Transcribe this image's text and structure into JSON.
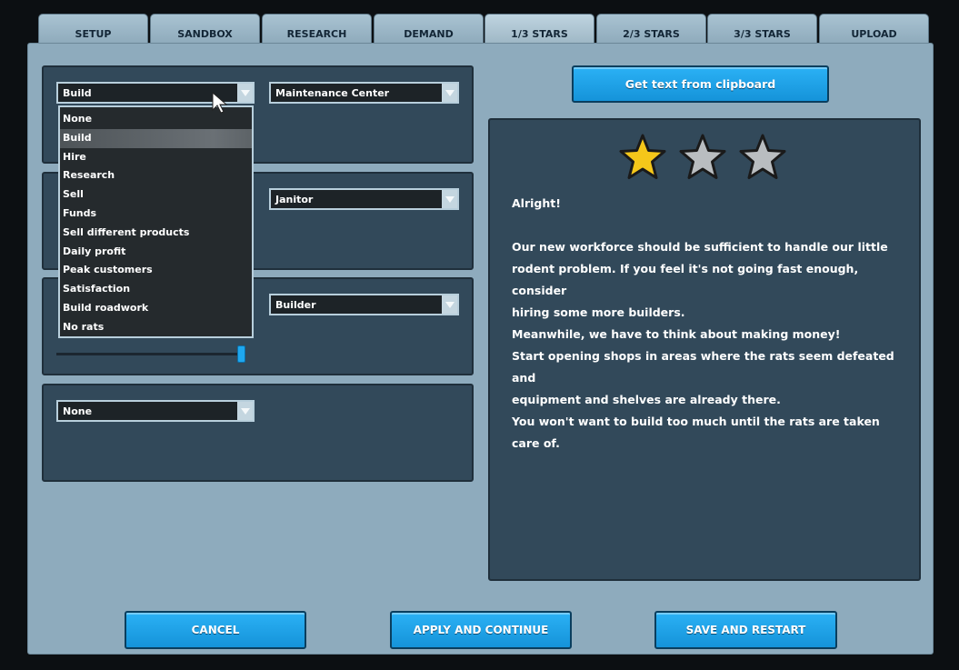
{
  "tabs": [
    {
      "label": "SETUP",
      "active": false
    },
    {
      "label": "SANDBOX",
      "active": false
    },
    {
      "label": "RESEARCH",
      "active": false
    },
    {
      "label": "DEMAND",
      "active": false
    },
    {
      "label": "1/3 STARS",
      "active": true
    },
    {
      "label": "2/3 STARS",
      "active": false
    },
    {
      "label": "3/3 STARS",
      "active": false
    },
    {
      "label": "UPLOAD",
      "active": false
    }
  ],
  "goals": [
    {
      "type": "Build",
      "target": "Maintenance Center"
    },
    {
      "target": "Janitor"
    },
    {
      "target": "Builder"
    },
    {
      "type": "None"
    }
  ],
  "dropdown_options": [
    "None",
    "Build",
    "Hire",
    "Research",
    "Sell",
    "Funds",
    "Sell different products",
    "Daily profit",
    "Peak customers",
    "Satisfaction",
    "Build roadwork",
    "No rats"
  ],
  "dropdown_selected": "Build",
  "slider": {
    "value": 1.0
  },
  "clipboard_button": "Get text from clipboard",
  "stars": {
    "filled": 1,
    "total": 3,
    "colors": {
      "filled": "#f5c71a",
      "empty": "#b9bdc0"
    }
  },
  "story_lines": [
    "Alright!",
    "",
    "Our new workforce should be sufficient to handle our little",
    "rodent problem. If you feel it's not going fast enough, consider",
    "hiring some more builders.",
    "Meanwhile, we have to think about making money!",
    "Start opening shops in areas where the rats seem defeated and",
    "equipment and shelves are already there.",
    "You won't want to build too much until the rats are taken care of."
  ],
  "buttons": {
    "cancel": "CANCEL",
    "apply": "APPLY AND CONTINUE",
    "save": "SAVE AND RESTART"
  },
  "colors": {
    "accent": "#1ea7ef",
    "panel": "#8eabbd",
    "box": "#32495a"
  }
}
